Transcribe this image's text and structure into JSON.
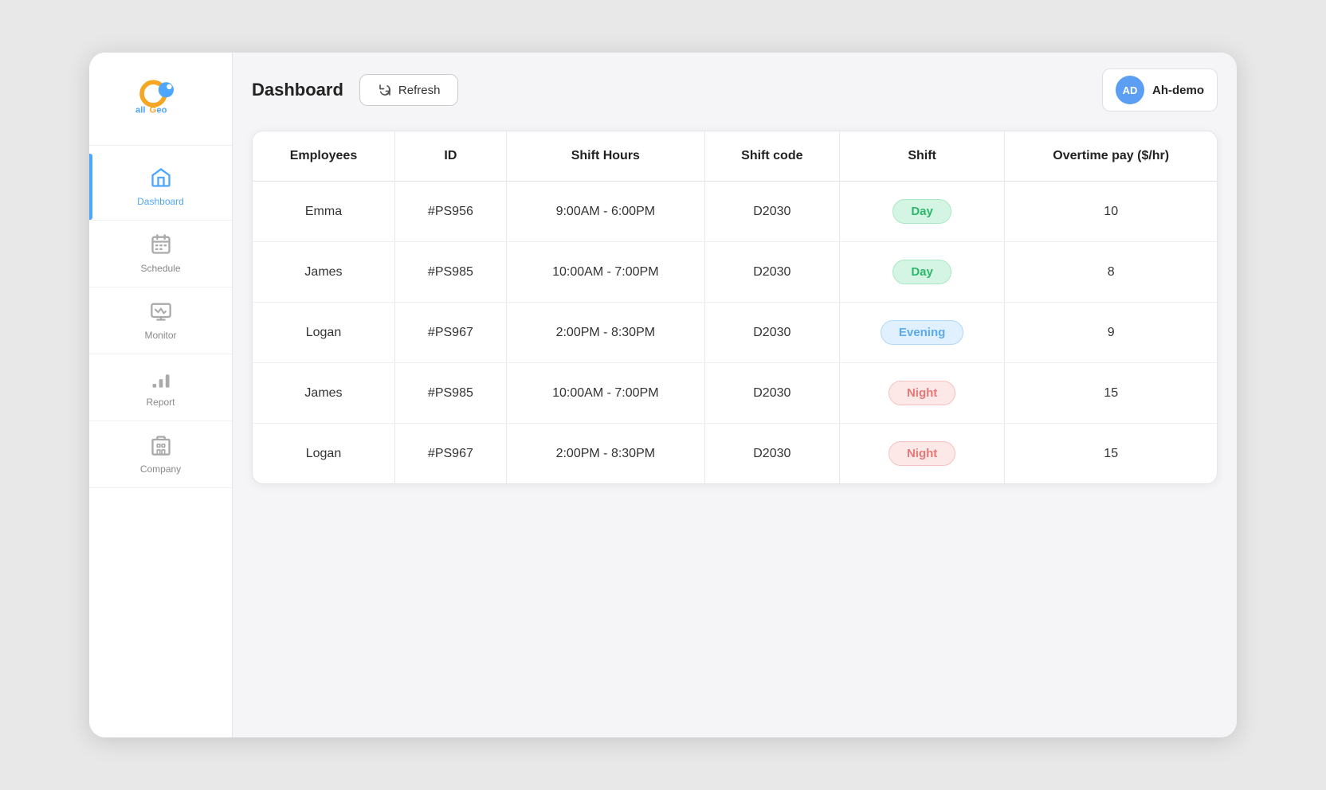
{
  "app": {
    "title": "allGeo"
  },
  "sidebar": {
    "items": [
      {
        "id": "dashboard",
        "label": "Dashboard",
        "active": true
      },
      {
        "id": "schedule",
        "label": "Schedule",
        "active": false
      },
      {
        "id": "monitor",
        "label": "Monitor",
        "active": false
      },
      {
        "id": "report",
        "label": "Report",
        "active": false
      },
      {
        "id": "company",
        "label": "Company",
        "active": false
      }
    ]
  },
  "header": {
    "page_title": "Dashboard",
    "refresh_label": "Refresh",
    "user_initials": "AD",
    "user_name": "Ah-demo"
  },
  "table": {
    "columns": [
      "Employees",
      "ID",
      "Shift Hours",
      "Shift code",
      "Shift",
      "Overtime pay ($/hr)"
    ],
    "rows": [
      {
        "employee": "Emma",
        "id": "#PS956",
        "hours": "9:00AM - 6:00PM",
        "shift_code": "D2030",
        "shift": "Day",
        "shift_type": "day",
        "overtime": "10"
      },
      {
        "employee": "James",
        "id": "#PS985",
        "hours": "10:00AM - 7:00PM",
        "shift_code": "D2030",
        "shift": "Day",
        "shift_type": "day",
        "overtime": "8"
      },
      {
        "employee": "Logan",
        "id": "#PS967",
        "hours": "2:00PM - 8:30PM",
        "shift_code": "D2030",
        "shift": "Evening",
        "shift_type": "evening",
        "overtime": "9"
      },
      {
        "employee": "James",
        "id": "#PS985",
        "hours": "10:00AM - 7:00PM",
        "shift_code": "D2030",
        "shift": "Night",
        "shift_type": "night",
        "overtime": "15"
      },
      {
        "employee": "Logan",
        "id": "#PS967",
        "hours": "2:00PM - 8:30PM",
        "shift_code": "D2030",
        "shift": "Night",
        "shift_type": "night",
        "overtime": "15"
      }
    ]
  }
}
